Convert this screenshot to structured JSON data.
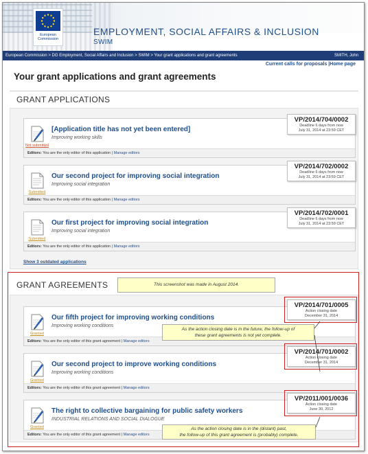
{
  "header": {
    "logo_text": "European Commission",
    "title": "EMPLOYMENT, SOCIAL AFFAIRS & INCLUSION",
    "subtitle": "SWIM"
  },
  "breadcrumb": {
    "path": "European Commission > DG Employment, Social Affairs and Inclusion > SWIM > Your grant applications and grant agreements",
    "user": "SMITH, John"
  },
  "toplinks": {
    "calls": "Current calls for proposals",
    "separator": "|",
    "home": "Home page"
  },
  "page_title": "Your grant applications and grant agreements",
  "applications": {
    "heading": "GRANT APPLICATIONS",
    "items": [
      {
        "title": "[Application title has not yet been entered]",
        "subtitle": "Improving working skills",
        "status": "Not submitted",
        "ref": "VP/2014/704/0002",
        "deadline_l1": "Deadline 6 days from now",
        "deadline_l2": "July 31, 2014 at 23:59 CET",
        "editors_label": "Editors:",
        "editors_text": "You are the only editor of this application",
        "manage": "Manage editors"
      },
      {
        "title": "Our second project for improving social integration",
        "subtitle": "Improving social integration",
        "status": "Submitted",
        "ref": "VP/2014/702/0002",
        "deadline_l1": "Deadline 6 days from now",
        "deadline_l2": "July 31, 2014 at 23:59 CET",
        "editors_label": "Editors:",
        "editors_text": "You are the only editor of this application",
        "manage": "Manage editors"
      },
      {
        "title": "Our first project for improving social integration",
        "subtitle": "Improving social integration",
        "status": "Submitted",
        "ref": "VP/2014/702/0001",
        "deadline_l1": "Deadline 6 days from now",
        "deadline_l2": "July 31, 2014 at 23:59 CET",
        "editors_label": "Editors:",
        "editors_text": "You are the only editor of this application",
        "manage": "Manage editors"
      }
    ],
    "show_outdated": "Show 3 outdated applications"
  },
  "agreements": {
    "heading": "GRANT AGREEMENTS",
    "note_top": "This screenshot was made in August 2014.",
    "items": [
      {
        "title": "Our fifth project for improving working conditions",
        "subtitle": "Improving working conditions",
        "status": "Granted",
        "ref": "VP/2014/701/0005",
        "date_l1": "Action closing date",
        "date_l2": "December 31, 2014",
        "editors_label": "Editors:",
        "editors_text": "You are the only editor of this grant agreement",
        "manage": "Manage editors"
      },
      {
        "title": "Our second project to improve working conditions",
        "subtitle": "Improving working conditions",
        "status": "Granted",
        "ref": "VP/2014/701/0002",
        "date_l1": "Action closing date",
        "date_l2": "December 31, 2014",
        "editors_label": "Editors:",
        "editors_text": "You are the only editor of this grant agreement",
        "manage": "Manage editors"
      },
      {
        "title": "The right to collective bargaining for public safety workers",
        "subtitle": "INDUSTRIAL RELATIONS AND SOCIAL DIALOGUE",
        "status": "Granted",
        "ref": "VP/2011/001/0036",
        "date_l1": "Action closing date",
        "date_l2": "June 30, 2012",
        "editors_label": "Editors:",
        "editors_text": "You are the only editor of this grant agreement",
        "manage": "Manage editors"
      }
    ],
    "note_future_l1": "As the action closing date is in the future, the follow-up of",
    "note_future_l2": "these grant agreements is not yet complete.",
    "note_past_l1": "As the action closing date is in the (distant) past,",
    "note_past_l2": "the follow-up of this grant agreement is (probably) complete."
  },
  "colors": {
    "brand_blue": "#1f4e8c",
    "breadcrumb_bg": "#1f3e78",
    "highlight_red": "#d02020",
    "note_bg": "#ffffc8"
  }
}
